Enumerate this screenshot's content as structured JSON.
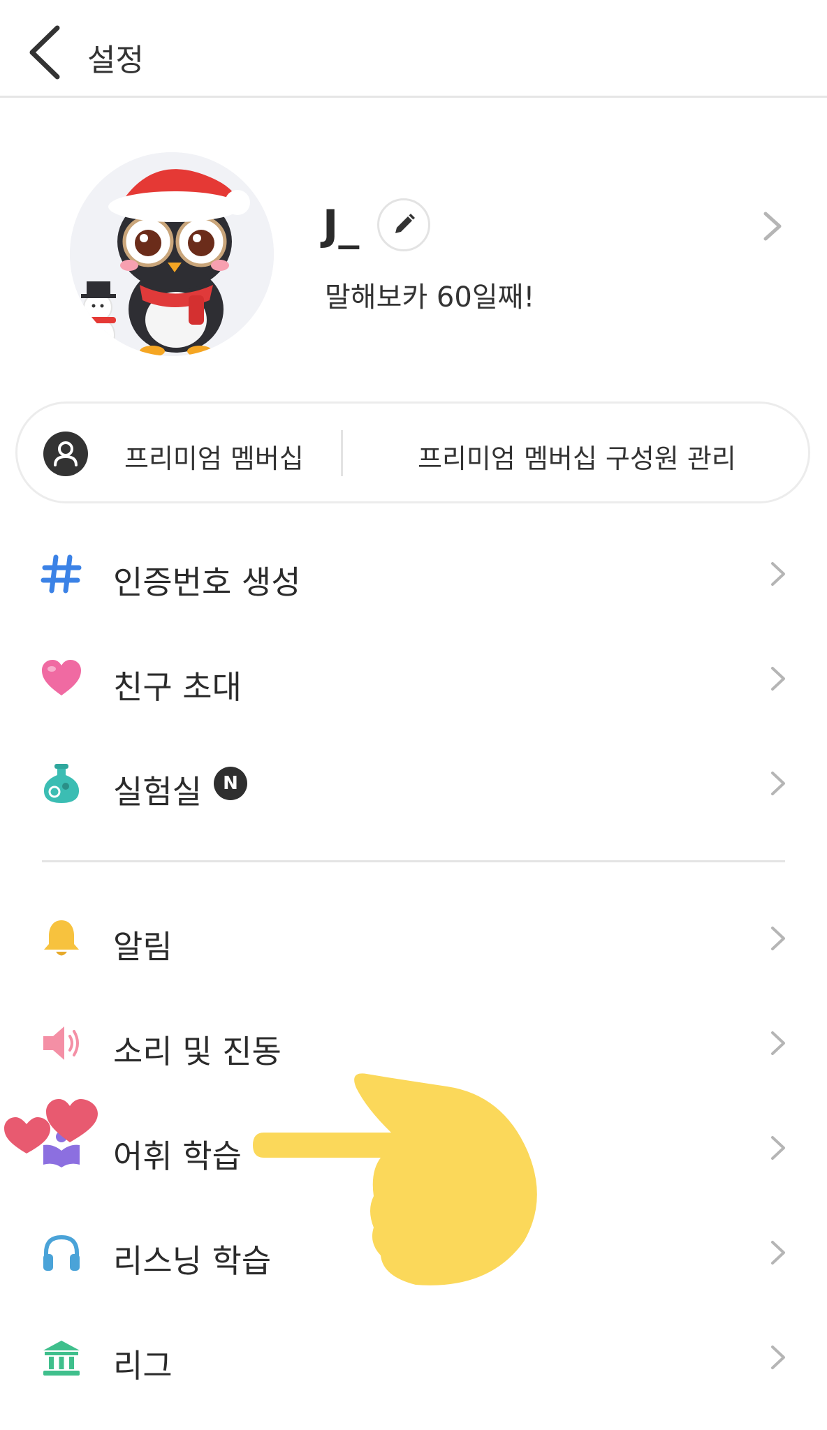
{
  "header": {
    "title": "설정"
  },
  "profile": {
    "username": "J_",
    "subtitle": "말해보카 60일째!"
  },
  "membership": {
    "label": "프리미엄 멤버십",
    "manage_label": "프리미엄 멤버십 구성원 관리"
  },
  "menu_group_1": [
    {
      "label": "인증번호 생성",
      "icon": "hash-icon",
      "color": "#3b82e6"
    },
    {
      "label": "친구 초대",
      "icon": "heart-icon",
      "color": "#f06aa2"
    },
    {
      "label": "실험실",
      "icon": "flask-icon",
      "color": "#3bbdb3",
      "badge": "N"
    }
  ],
  "menu_group_2": [
    {
      "label": "알림",
      "icon": "bell-icon",
      "color": "#f7c23e"
    },
    {
      "label": "소리 및 진동",
      "icon": "speaker-icon",
      "color": "#f48fa5"
    },
    {
      "label": "어휘 학습",
      "icon": "book-icon",
      "color": "#8c6fe0"
    },
    {
      "label": "리스닝 학습",
      "icon": "headphones-icon",
      "color": "#4aa3d8"
    },
    {
      "label": "리그",
      "icon": "league-icon",
      "color": "#3fbf8c"
    }
  ],
  "colors": {
    "chevron": "#b5b5b5",
    "divider": "#e4e4e4",
    "overlay_hand": "#fbd85a",
    "overlay_hearts": "#e85a70"
  }
}
